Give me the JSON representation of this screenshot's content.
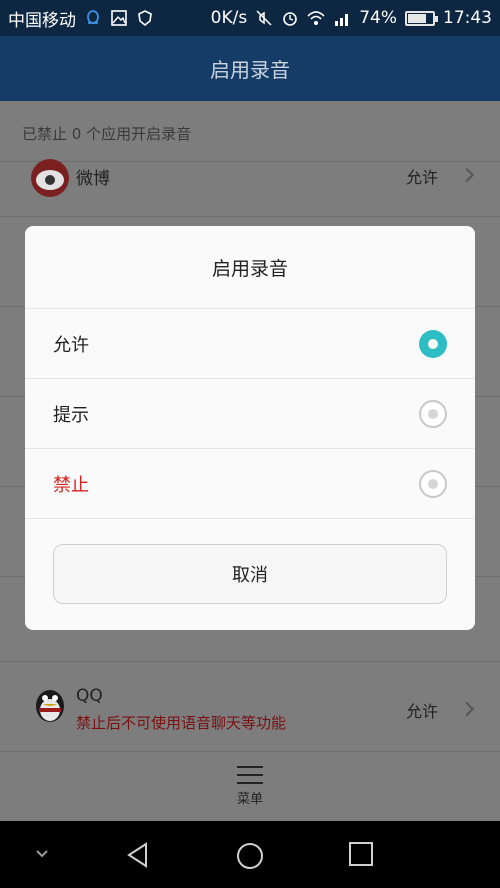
{
  "status_bar": {
    "carrier": "中国移动",
    "speed": "0K/s",
    "battery": "74%",
    "battery_level": 0.74,
    "time": "17:43"
  },
  "appbar": {
    "title": "启用录音"
  },
  "page": {
    "subtitle": "已禁止 0 个应用开启录音",
    "rows": [
      {
        "name": "微博",
        "status": "允许"
      },
      {
        "name": "QQ",
        "warning": "禁止后不可使用语音聊天等功能",
        "status": "允许"
      }
    ],
    "menu_label": "菜单"
  },
  "dialog": {
    "title": "启用录音",
    "options": [
      {
        "label": "允许",
        "selected": true
      },
      {
        "label": "提示",
        "selected": false
      },
      {
        "label": "禁止",
        "selected": false
      }
    ],
    "cancel_label": "取消"
  },
  "colors": {
    "accent": "#2cbdc5",
    "danger": "#d5231e",
    "appbar": "#153c67"
  }
}
